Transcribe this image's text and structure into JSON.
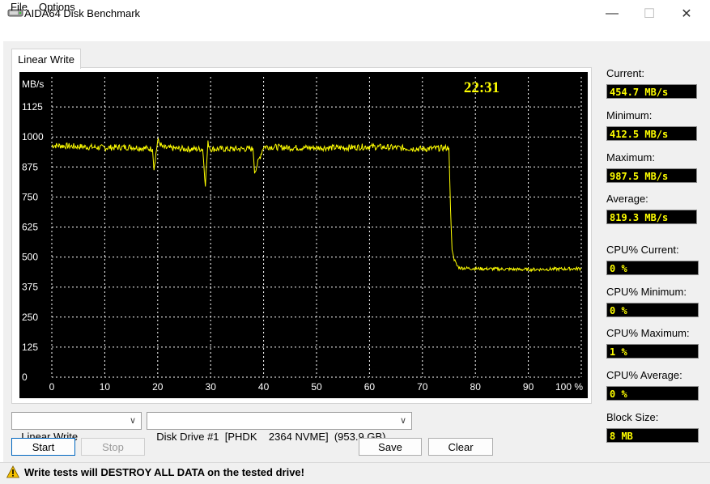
{
  "window": {
    "title": "AIDA64 Disk Benchmark",
    "minimize_glyph": "—",
    "maximize_glyph": "☐",
    "close_glyph": "✕"
  },
  "menu": {
    "file": "File",
    "options": "Options"
  },
  "tab": {
    "label": "Linear Write"
  },
  "graph": {
    "y_unit": "MB/s",
    "clock": "22:31",
    "y_ticks": [
      "1125",
      "1000",
      "875",
      "750",
      "625",
      "500",
      "375",
      "250",
      "125",
      "0"
    ],
    "x_ticks": [
      "0",
      "10",
      "20",
      "30",
      "40",
      "50",
      "60",
      "70",
      "80",
      "90",
      "100 %"
    ]
  },
  "chart_data": {
    "type": "line",
    "ylabel": "MB/s",
    "ylim": [
      0,
      1250
    ],
    "xlim": [
      0,
      100
    ],
    "grid": true,
    "series": [
      {
        "x": [
          0,
          5,
          10,
          15,
          19,
          19.3,
          20,
          21,
          25,
          28.5,
          29,
          29.5,
          30,
          35,
          38,
          38.3,
          40,
          45,
          50,
          55,
          60,
          65,
          70,
          75,
          75.3,
          75.6,
          76,
          76.5,
          77,
          80,
          85,
          90,
          95,
          100
        ],
        "y": [
          965,
          960,
          955,
          958,
          950,
          870,
          985,
          955,
          950,
          950,
          805,
          975,
          950,
          950,
          950,
          855,
          960,
          955,
          955,
          955,
          960,
          955,
          950,
          955,
          700,
          530,
          490,
          465,
          455,
          452,
          450,
          448,
          450,
          452
        ]
      }
    ],
    "color": "#ffff00"
  },
  "stats": {
    "current_label": "Current:",
    "current_value": "454.7 MB/s",
    "minimum_label": "Minimum:",
    "minimum_value": "412.5 MB/s",
    "maximum_label": "Maximum:",
    "maximum_value": "987.5 MB/s",
    "average_label": "Average:",
    "average_value": "819.3 MB/s",
    "cpu_current_label": "CPU% Current:",
    "cpu_current_value": "0 %",
    "cpu_min_label": "CPU% Minimum:",
    "cpu_min_value": "0 %",
    "cpu_max_label": "CPU% Maximum:",
    "cpu_max_value": "1 %",
    "cpu_avg_label": "CPU% Average:",
    "cpu_avg_value": "0 %",
    "block_label": "Block Size:",
    "block_value": "8 MB"
  },
  "controls": {
    "test_select": "Linear Write",
    "drive_select": "Disk Drive #1  [PHDK    2364 NVME]  (953.9 GB)",
    "start": "Start",
    "stop": "Stop",
    "save": "Save",
    "clear": "Clear"
  },
  "status": {
    "warning": "Write tests will DESTROY ALL DATA on the tested drive!"
  },
  "colors": {
    "graph_bg": "#000000",
    "grid": "#ffffff",
    "line": "#ffff00",
    "value_text": "#ffff00"
  }
}
